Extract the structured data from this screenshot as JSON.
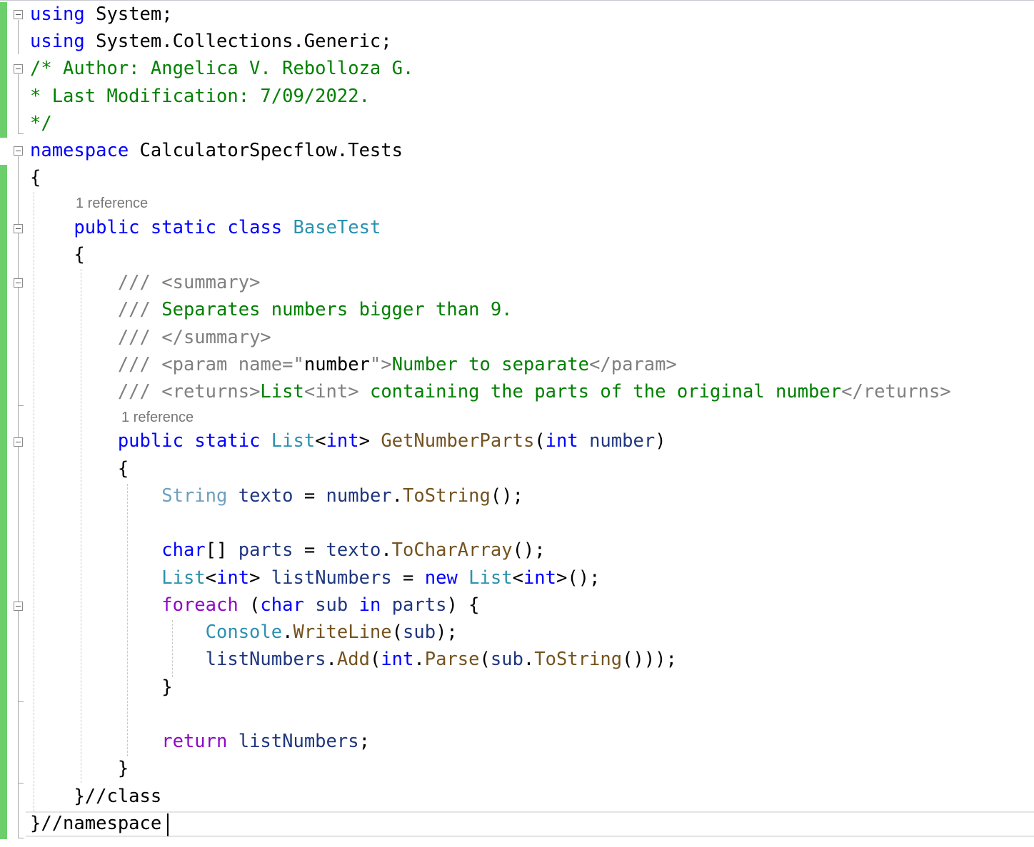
{
  "editor": {
    "codelens": [
      "1 reference",
      "1 reference"
    ],
    "lines": [
      [
        {
          "t": "using",
          "c": "kw"
        },
        {
          "t": " System;"
        }
      ],
      [
        {
          "t": "using",
          "c": "kw"
        },
        {
          "t": " System.Collections.Generic;"
        }
      ],
      [
        {
          "t": "/* Author: Angelica V. Rebolloza G.",
          "c": "cm"
        }
      ],
      [
        {
          "t": "* Last Modification: 7/09/2022.",
          "c": "cm"
        }
      ],
      [
        {
          "t": "*/",
          "c": "cm"
        }
      ],
      [
        {
          "t": "namespace",
          "c": "kw"
        },
        {
          "t": " CalculatorSpecflow.Tests"
        }
      ],
      [
        {
          "t": "{"
        }
      ],
      [
        {
          "t": "    "
        },
        {
          "t": "public",
          "c": "kw"
        },
        {
          "t": " "
        },
        {
          "t": "static",
          "c": "kw"
        },
        {
          "t": " "
        },
        {
          "t": "class",
          "c": "kw"
        },
        {
          "t": " "
        },
        {
          "t": "BaseTest",
          "c": "type"
        }
      ],
      [
        {
          "t": "    {"
        }
      ],
      [
        {
          "t": "        "
        },
        {
          "t": "/// ",
          "c": "xd"
        },
        {
          "t": "<summary>",
          "c": "xd"
        }
      ],
      [
        {
          "t": "        "
        },
        {
          "t": "/// ",
          "c": "xd"
        },
        {
          "t": "Separates numbers bigger than 9.",
          "c": "cm"
        }
      ],
      [
        {
          "t": "        "
        },
        {
          "t": "/// ",
          "c": "xd"
        },
        {
          "t": "</summary>",
          "c": "xd"
        }
      ],
      [
        {
          "t": "        "
        },
        {
          "t": "/// ",
          "c": "xd"
        },
        {
          "t": "<param name=\"",
          "c": "xd"
        },
        {
          "t": "number"
        },
        {
          "t": "\">",
          "c": "xd"
        },
        {
          "t": "Number to separate",
          "c": "cm"
        },
        {
          "t": "</param>",
          "c": "xd"
        }
      ],
      [
        {
          "t": "        "
        },
        {
          "t": "/// ",
          "c": "xd"
        },
        {
          "t": "<returns>",
          "c": "xd"
        },
        {
          "t": "List",
          "c": "cm"
        },
        {
          "t": "<int>",
          "c": "xd"
        },
        {
          "t": " containing the parts of the original number",
          "c": "cm"
        },
        {
          "t": "</returns>",
          "c": "xd"
        }
      ],
      [
        {
          "t": "        "
        },
        {
          "t": "public",
          "c": "kw"
        },
        {
          "t": " "
        },
        {
          "t": "static",
          "c": "kw"
        },
        {
          "t": " "
        },
        {
          "t": "List",
          "c": "type"
        },
        {
          "t": "<"
        },
        {
          "t": "int",
          "c": "kw"
        },
        {
          "t": "> "
        },
        {
          "t": "GetNumberParts",
          "c": "fn"
        },
        {
          "t": "("
        },
        {
          "t": "int",
          "c": "kw"
        },
        {
          "t": " "
        },
        {
          "t": "number",
          "c": "var"
        },
        {
          "t": ")"
        }
      ],
      [
        {
          "t": "        {"
        }
      ],
      [
        {
          "t": "            "
        },
        {
          "t": "String",
          "c": "ptype"
        },
        {
          "t": " "
        },
        {
          "t": "texto",
          "c": "var"
        },
        {
          "t": " = "
        },
        {
          "t": "number",
          "c": "var"
        },
        {
          "t": "."
        },
        {
          "t": "ToString",
          "c": "fn"
        },
        {
          "t": "();"
        }
      ],
      [
        {
          "t": ""
        }
      ],
      [
        {
          "t": "            "
        },
        {
          "t": "char",
          "c": "kw"
        },
        {
          "t": "[] "
        },
        {
          "t": "parts",
          "c": "var"
        },
        {
          "t": " = "
        },
        {
          "t": "texto",
          "c": "var"
        },
        {
          "t": "."
        },
        {
          "t": "ToCharArray",
          "c": "fn"
        },
        {
          "t": "();"
        }
      ],
      [
        {
          "t": "            "
        },
        {
          "t": "List",
          "c": "type"
        },
        {
          "t": "<"
        },
        {
          "t": "int",
          "c": "kw"
        },
        {
          "t": "> "
        },
        {
          "t": "listNumbers",
          "c": "var"
        },
        {
          "t": " = "
        },
        {
          "t": "new",
          "c": "kw"
        },
        {
          "t": " "
        },
        {
          "t": "List",
          "c": "type"
        },
        {
          "t": "<"
        },
        {
          "t": "int",
          "c": "kw"
        },
        {
          "t": ">();"
        }
      ],
      [
        {
          "t": "            "
        },
        {
          "t": "foreach",
          "c": "ctl"
        },
        {
          "t": " ("
        },
        {
          "t": "char",
          "c": "kw"
        },
        {
          "t": " "
        },
        {
          "t": "sub",
          "c": "var"
        },
        {
          "t": " "
        },
        {
          "t": "in",
          "c": "kw"
        },
        {
          "t": " "
        },
        {
          "t": "parts",
          "c": "var"
        },
        {
          "t": ") {"
        }
      ],
      [
        {
          "t": "                "
        },
        {
          "t": "Console",
          "c": "type"
        },
        {
          "t": "."
        },
        {
          "t": "WriteLine",
          "c": "fn"
        },
        {
          "t": "("
        },
        {
          "t": "sub",
          "c": "var"
        },
        {
          "t": ");"
        }
      ],
      [
        {
          "t": "                "
        },
        {
          "t": "listNumbers",
          "c": "var"
        },
        {
          "t": "."
        },
        {
          "t": "Add",
          "c": "fn"
        },
        {
          "t": "("
        },
        {
          "t": "int",
          "c": "kw"
        },
        {
          "t": "."
        },
        {
          "t": "Parse",
          "c": "fn"
        },
        {
          "t": "("
        },
        {
          "t": "sub",
          "c": "var"
        },
        {
          "t": "."
        },
        {
          "t": "ToString",
          "c": "fn"
        },
        {
          "t": "()));"
        }
      ],
      [
        {
          "t": "            }"
        }
      ],
      [
        {
          "t": ""
        }
      ],
      [
        {
          "t": "            "
        },
        {
          "t": "return",
          "c": "ctl"
        },
        {
          "t": " "
        },
        {
          "t": "listNumbers",
          "c": "var"
        },
        {
          "t": ";"
        }
      ],
      [
        {
          "t": "        }"
        }
      ],
      [
        {
          "t": "    }//class"
        }
      ],
      [
        {
          "t": "}//namespace"
        }
      ]
    ]
  }
}
